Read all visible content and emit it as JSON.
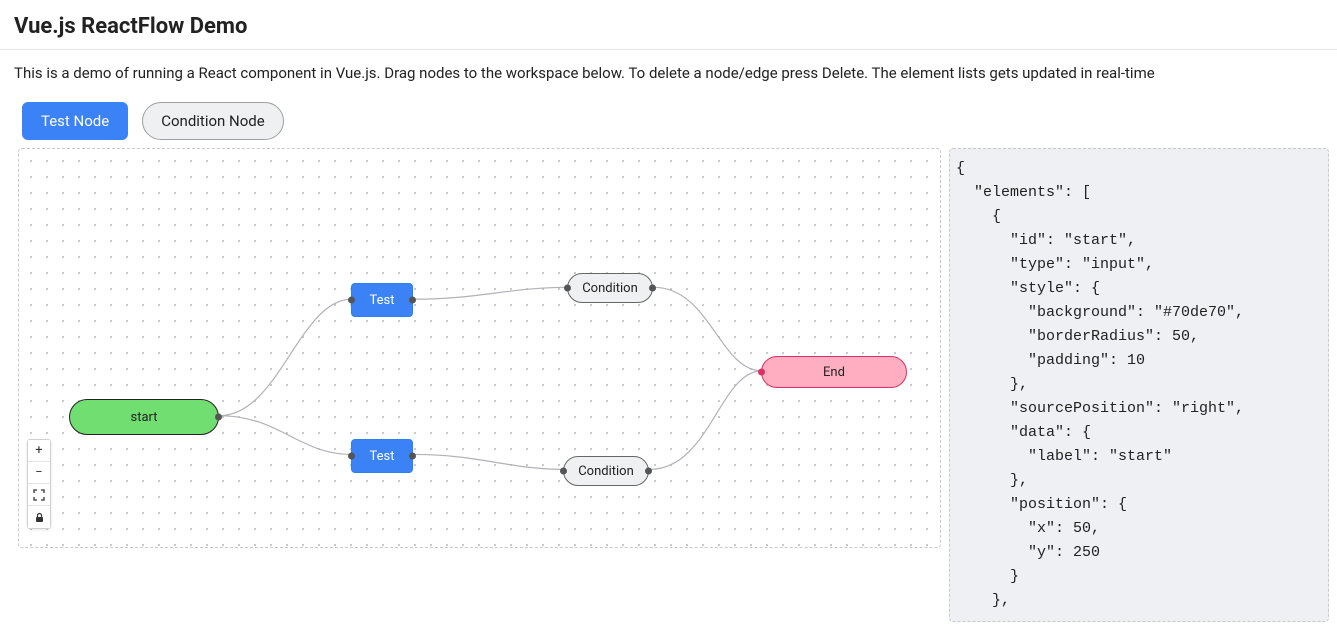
{
  "header": {
    "title": "Vue.js ReactFlow Demo",
    "intro": "This is a demo of running a React component in Vue.js. Drag nodes to the workspace below. To delete a node/edge press Delete. The element lists gets updated in real-time"
  },
  "toolbar": {
    "test_node_label": "Test Node",
    "condition_node_label": "Condition Node"
  },
  "nodes": {
    "start_label": "start",
    "test1_label": "Test",
    "test2_label": "Test",
    "cond1_label": "Condition",
    "cond2_label": "Condition",
    "end_label": "End"
  },
  "json_preview": "{\n  \"elements\": [\n    {\n      \"id\": \"start\",\n      \"type\": \"input\",\n      \"style\": {\n        \"background\": \"#70de70\",\n        \"borderRadius\": 50,\n        \"padding\": 10\n      },\n      \"sourcePosition\": \"right\",\n      \"data\": {\n        \"label\": \"start\"\n      },\n      \"position\": {\n        \"x\": 50,\n        \"y\": 250\n      }\n    },"
}
